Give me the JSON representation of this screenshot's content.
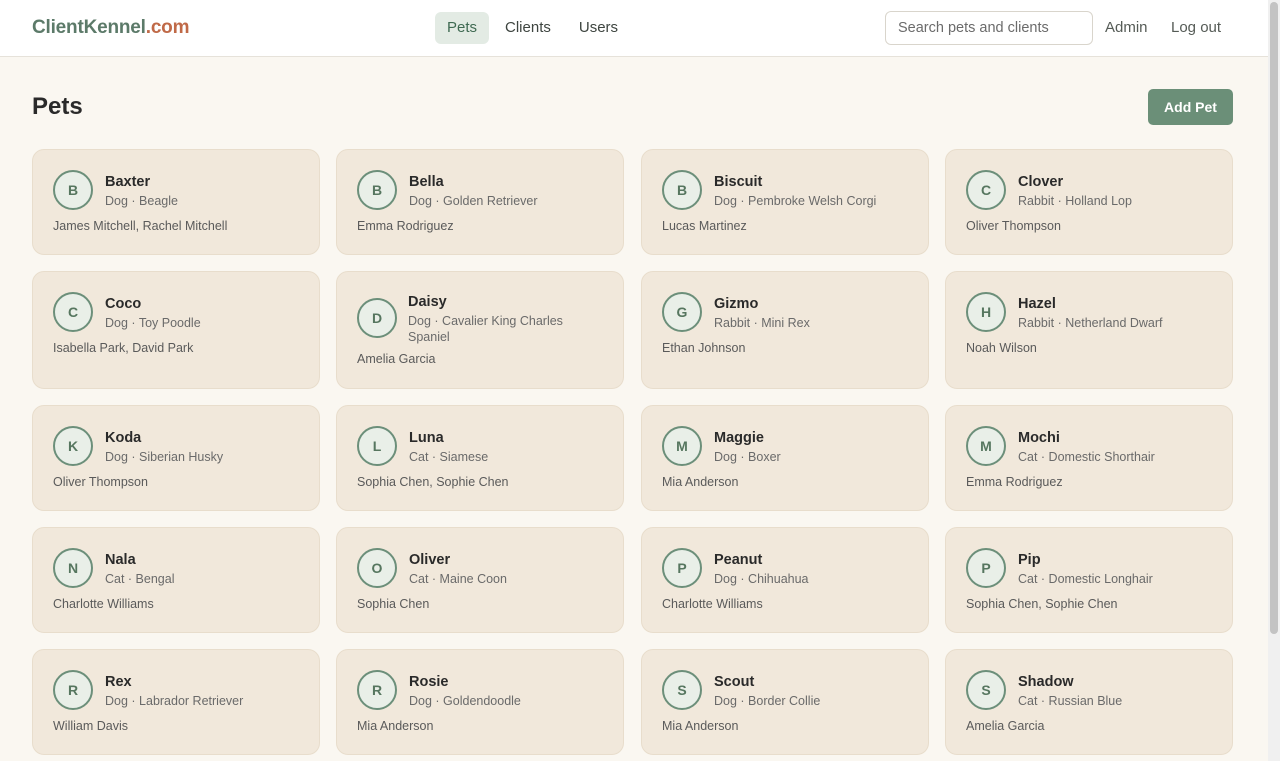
{
  "header": {
    "logo_main": "ClientKennel",
    "logo_tld": ".com",
    "nav": [
      {
        "label": "Pets",
        "active": true
      },
      {
        "label": "Clients",
        "active": false
      },
      {
        "label": "Users",
        "active": false
      }
    ],
    "search_placeholder": "Search pets and clients",
    "admin_label": "Admin",
    "logout_label": "Log out"
  },
  "page": {
    "title": "Pets",
    "add_button": "Add Pet"
  },
  "pets": [
    {
      "initial": "B",
      "name": "Baxter",
      "breed": "Dog · Beagle",
      "owners": "James Mitchell, Rachel Mitchell"
    },
    {
      "initial": "B",
      "name": "Bella",
      "breed": "Dog · Golden Retriever",
      "owners": "Emma Rodriguez"
    },
    {
      "initial": "B",
      "name": "Biscuit",
      "breed": "Dog · Pembroke Welsh Corgi",
      "owners": "Lucas Martinez"
    },
    {
      "initial": "C",
      "name": "Clover",
      "breed": "Rabbit · Holland Lop",
      "owners": "Oliver Thompson"
    },
    {
      "initial": "C",
      "name": "Coco",
      "breed": "Dog · Toy Poodle",
      "owners": "Isabella Park, David Park"
    },
    {
      "initial": "D",
      "name": "Daisy",
      "breed": "Dog · Cavalier King Charles Spaniel",
      "owners": "Amelia Garcia"
    },
    {
      "initial": "G",
      "name": "Gizmo",
      "breed": "Rabbit · Mini Rex",
      "owners": "Ethan Johnson"
    },
    {
      "initial": "H",
      "name": "Hazel",
      "breed": "Rabbit · Netherland Dwarf",
      "owners": "Noah Wilson"
    },
    {
      "initial": "K",
      "name": "Koda",
      "breed": "Dog · Siberian Husky",
      "owners": "Oliver Thompson"
    },
    {
      "initial": "L",
      "name": "Luna",
      "breed": "Cat · Siamese",
      "owners": "Sophia Chen, Sophie Chen"
    },
    {
      "initial": "M",
      "name": "Maggie",
      "breed": "Dog · Boxer",
      "owners": "Mia Anderson"
    },
    {
      "initial": "M",
      "name": "Mochi",
      "breed": "Cat · Domestic Shorthair",
      "owners": "Emma Rodriguez"
    },
    {
      "initial": "N",
      "name": "Nala",
      "breed": "Cat · Bengal",
      "owners": "Charlotte Williams"
    },
    {
      "initial": "O",
      "name": "Oliver",
      "breed": "Cat · Maine Coon",
      "owners": "Sophia Chen"
    },
    {
      "initial": "P",
      "name": "Peanut",
      "breed": "Dog · Chihuahua",
      "owners": "Charlotte Williams"
    },
    {
      "initial": "P",
      "name": "Pip",
      "breed": "Cat · Domestic Longhair",
      "owners": "Sophia Chen, Sophie Chen"
    },
    {
      "initial": "R",
      "name": "Rex",
      "breed": "Dog · Labrador Retriever",
      "owners": "William Davis"
    },
    {
      "initial": "R",
      "name": "Rosie",
      "breed": "Dog · Goldendoodle",
      "owners": "Mia Anderson"
    },
    {
      "initial": "S",
      "name": "Scout",
      "breed": "Dog · Border Collie",
      "owners": "Mia Anderson"
    },
    {
      "initial": "S",
      "name": "Shadow",
      "breed": "Cat · Russian Blue",
      "owners": "Amelia Garcia"
    }
  ]
}
